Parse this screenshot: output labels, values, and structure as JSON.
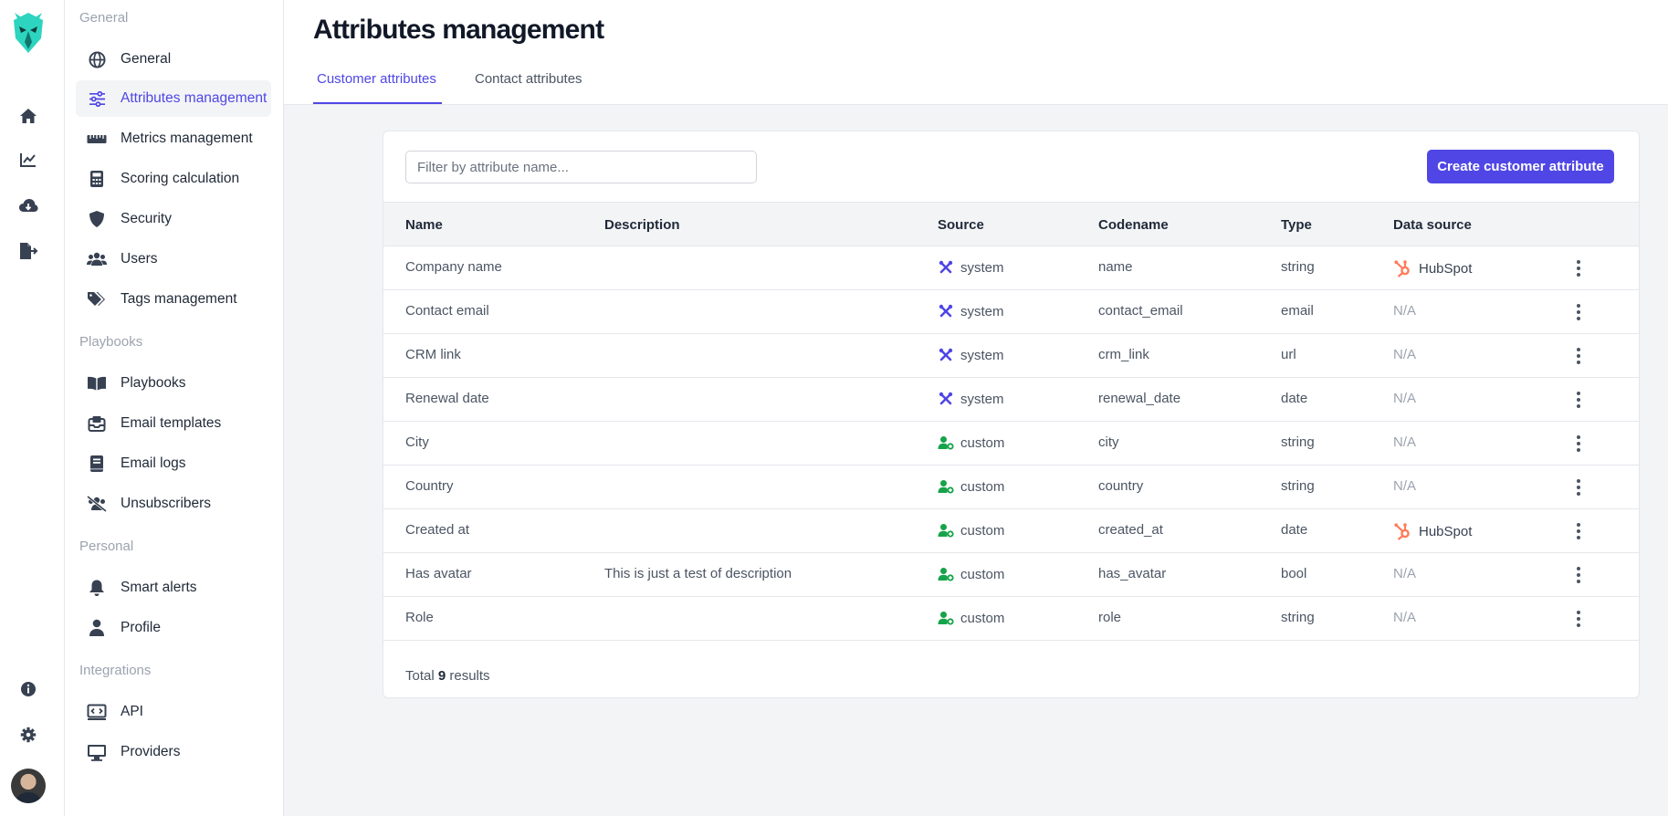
{
  "rail": {
    "icons": [
      "logo-icon",
      "home-icon",
      "analytics-icon",
      "cloud-download-icon",
      "file-export-icon",
      "info-icon",
      "settings-gear-icon"
    ]
  },
  "sidebar": {
    "sections": [
      {
        "title": "General",
        "items": [
          {
            "label": "General",
            "icon": "globe-icon"
          },
          {
            "label": "Attributes management",
            "icon": "sliders-icon",
            "active": true
          },
          {
            "label": "Metrics management",
            "icon": "ruler-icon"
          },
          {
            "label": "Scoring calculation",
            "icon": "calculator-icon"
          },
          {
            "label": "Security",
            "icon": "shield-icon"
          },
          {
            "label": "Users",
            "icon": "users-icon"
          },
          {
            "label": "Tags management",
            "icon": "tags-icon"
          }
        ]
      },
      {
        "title": "Playbooks",
        "items": [
          {
            "label": "Playbooks",
            "icon": "book-open-icon"
          },
          {
            "label": "Email templates",
            "icon": "inbox-icon"
          },
          {
            "label": "Email logs",
            "icon": "book-icon"
          },
          {
            "label": "Unsubscribers",
            "icon": "users-slash-icon"
          }
        ]
      },
      {
        "title": "Personal",
        "items": [
          {
            "label": "Smart alerts",
            "icon": "bell-icon"
          },
          {
            "label": "Profile",
            "icon": "user-icon"
          }
        ]
      },
      {
        "title": "Integrations",
        "items": [
          {
            "label": "API",
            "icon": "code-icon"
          },
          {
            "label": "Providers",
            "icon": "desktop-icon"
          }
        ]
      }
    ]
  },
  "header": {
    "title": "Attributes management",
    "tabs": [
      {
        "label": "Customer attributes",
        "active": true
      },
      {
        "label": "Contact attributes",
        "active": false
      }
    ]
  },
  "toolbar": {
    "filter_placeholder": "Filter by attribute name...",
    "filter_value": "",
    "create_label": "Create customer attribute"
  },
  "table": {
    "columns": [
      "Name",
      "Description",
      "Source",
      "Codename",
      "Type",
      "Data source"
    ],
    "rows": [
      {
        "name": "Company name",
        "description": "",
        "source": "system",
        "codename": "name",
        "type": "string",
        "data_source": "HubSpot"
      },
      {
        "name": "Contact email",
        "description": "",
        "source": "system",
        "codename": "contact_email",
        "type": "email",
        "data_source": "N/A"
      },
      {
        "name": "CRM link",
        "description": "",
        "source": "system",
        "codename": "crm_link",
        "type": "url",
        "data_source": "N/A"
      },
      {
        "name": "Renewal date",
        "description": "",
        "source": "system",
        "codename": "renewal_date",
        "type": "date",
        "data_source": "N/A"
      },
      {
        "name": "City",
        "description": "",
        "source": "custom",
        "codename": "city",
        "type": "string",
        "data_source": "N/A"
      },
      {
        "name": "Country",
        "description": "",
        "source": "custom",
        "codename": "country",
        "type": "string",
        "data_source": "N/A"
      },
      {
        "name": "Created at",
        "description": "",
        "source": "custom",
        "codename": "created_at",
        "type": "date",
        "data_source": "HubSpot"
      },
      {
        "name": "Has avatar",
        "description": "This is just a test of description",
        "source": "custom",
        "codename": "has_avatar",
        "type": "bool",
        "data_source": "N/A"
      },
      {
        "name": "Role",
        "description": "",
        "source": "custom",
        "codename": "role",
        "type": "string",
        "data_source": "N/A"
      }
    ]
  },
  "footer": {
    "prefix": "Total",
    "count": "9",
    "suffix": "results"
  },
  "colors": {
    "accent": "#4f46e5",
    "system": "#4f46e5",
    "custom": "#16a34a",
    "hubspot": "#ff7a59"
  }
}
